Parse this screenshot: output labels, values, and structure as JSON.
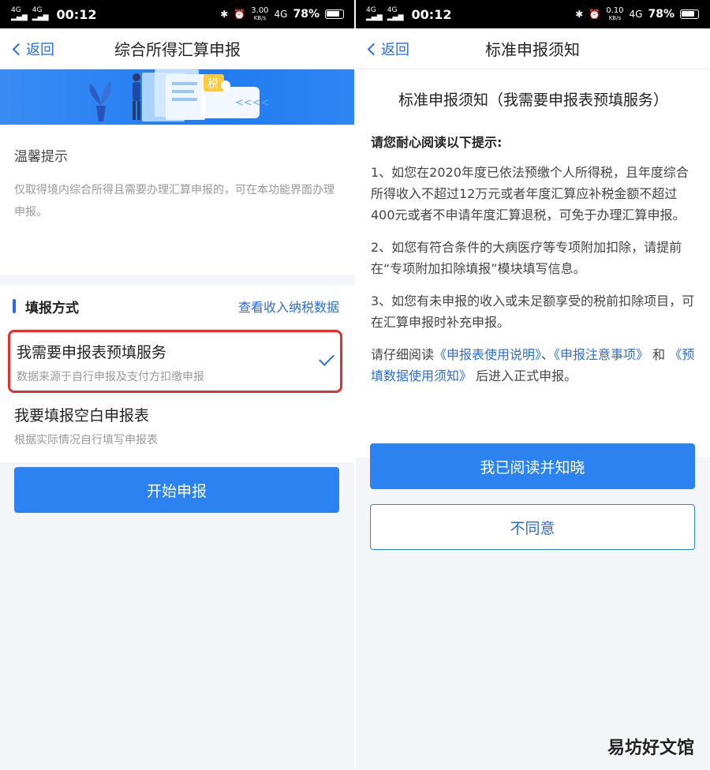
{
  "status_bar": {
    "signal_1": "4G",
    "signal_2": "4G",
    "time": "00:12",
    "left_speed_value": "3.00",
    "right_speed_value": "0.10",
    "speed_unit": "KB/s",
    "network": "4G",
    "battery": "78%"
  },
  "left_screen": {
    "nav": {
      "back_label": "返回",
      "title": "综合所得汇算申报"
    },
    "banner": {
      "tax_badge": "税",
      "arrows": "<<<<"
    },
    "tips": {
      "title": "温馨提示",
      "body": "仅取得境内综合所得且需要办理汇算申报的，可在本功能界面办理申报。"
    },
    "method": {
      "label": "填报方式",
      "link": "查看收入纳税数据"
    },
    "options": [
      {
        "title": "我需要申报表预填服务",
        "subtitle": "数据来源于自行申报及支付方扣缴申报",
        "selected": true
      },
      {
        "title": "我要填报空白申报表",
        "subtitle": "根据实际情况自行填写申报表",
        "selected": false
      }
    ],
    "start_button": "开始申报"
  },
  "right_screen": {
    "nav": {
      "back_label": "返回",
      "title": "标准申报须知"
    },
    "notice": {
      "title": "标准申报须知（我需要申报表预填服务）",
      "subtitle": "请您耐心阅读以下提示:",
      "item_1": "1、如您在2020年度已依法预缴个人所得税，且年度综合所得收入不超过12万元或者年度汇算应补税金额不超过400元或者不申请年度汇算退税，可免于办理汇算申报。",
      "item_2": "2、如您有符合条件的大病医疗等专项附加扣除，请提前在“专项附加扣除填报”模块填写信息。",
      "item_3": "3、如您有未申报的收入或未足额享受的税前扣除项目，可在汇算申报时补充申报。",
      "read_prefix": "请仔细阅读",
      "link_1": "《申报表使用说明》",
      "sep_1": "、",
      "link_2": "《申报注意事项》",
      "sep_2": "和",
      "link_3": "《预填数据使用须知》",
      "read_suffix": "后进入正式申报。"
    },
    "agree_button": "我已阅读并知晓",
    "disagree_button": "不同意"
  },
  "corner_watermark": "易坊好文馆",
  "colors": {
    "accent_blue": "#2b82f0",
    "link_blue": "#2a6ed9",
    "highlight_red": "#e03030"
  }
}
